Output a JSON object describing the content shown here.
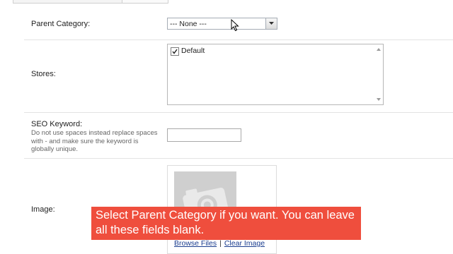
{
  "form": {
    "parent_category": {
      "label": "Parent Category:",
      "selected": "--- None ---"
    },
    "stores": {
      "label": "Stores:",
      "options": [
        {
          "label": "Default",
          "checked": true
        }
      ]
    },
    "seo_keyword": {
      "label": "SEO Keyword:",
      "help": "Do not use spaces instead replace spaces with - and make sure the keyword is globally unique.",
      "value": ""
    },
    "image": {
      "label": "Image:",
      "browse_label": "Browse Files",
      "separator": "|",
      "clear_label": "Clear Image"
    }
  },
  "caption": {
    "text": "Select Parent Category if you want. You can leave all these fields blank.",
    "color": "#ef4e3d"
  },
  "colors": {
    "link": "#1b3d8f",
    "divider": "#e3e3e3"
  }
}
